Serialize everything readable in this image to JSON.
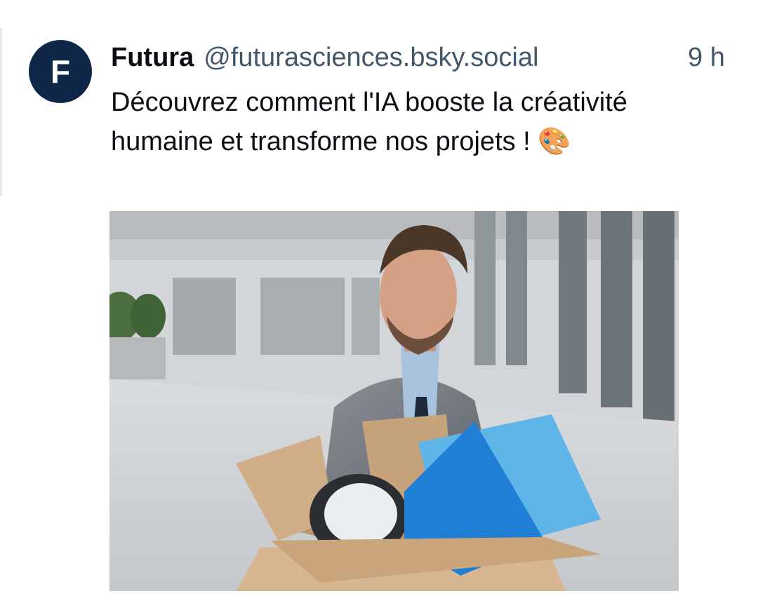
{
  "post": {
    "avatar_letter": "F",
    "author_name": "Futura",
    "author_handle": "@futurasciences.bsky.social",
    "timestamp": "9 h",
    "text": "Découvrez comment l'IA booste la créativité humaine et transforme nos projets ! 🎨"
  },
  "colors": {
    "avatar_bg": "#0e2749",
    "handle": "#42576c",
    "text": "#0b0f14"
  },
  "icons": [
    "palette-emoji"
  ]
}
